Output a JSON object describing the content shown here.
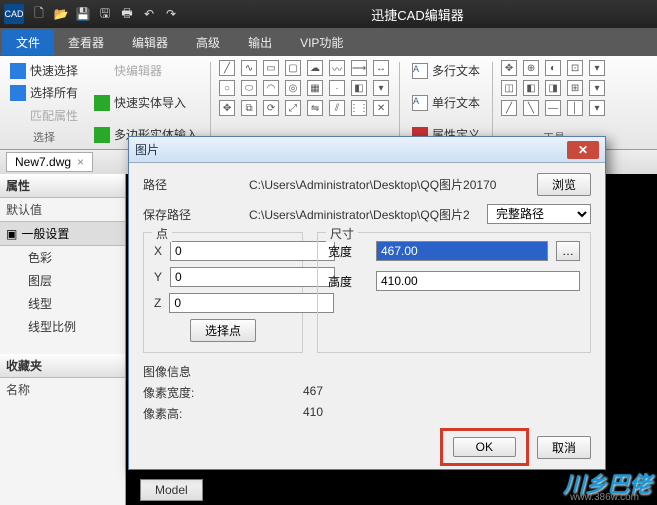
{
  "app": {
    "title": "迅捷CAD编辑器",
    "logo": "CAD"
  },
  "toolbar_icons": [
    "new",
    "open",
    "save",
    "saveall",
    "print",
    "undo",
    "redo"
  ],
  "menu": {
    "file": "文件",
    "view": "查看器",
    "editor": "编辑器",
    "advanced": "高级",
    "output": "输出",
    "vip": "VIP功能"
  },
  "ribbon": {
    "quick_select": "快速选择",
    "quick_editor": "快编辑器",
    "select_all": "选择所有",
    "quick_entity_import": "快速实体导入",
    "match_props": "匹配属性",
    "poly_entity_input": "多边形实体输入",
    "group_select": "选择",
    "mtext": "多行文本",
    "stext": "单行文本",
    "attdef": "属性定义",
    "group_tools": "工具"
  },
  "doc_tab": {
    "name": "New7.dwg"
  },
  "side": {
    "props": "属性",
    "default": "默认值",
    "section_general": "一般设置",
    "color": "色彩",
    "layer": "图层",
    "ltype": "线型",
    "lscale": "线型比例",
    "favorites": "收藏夹",
    "name": "名称"
  },
  "model_tab": "Model",
  "dialog": {
    "title": "图片",
    "path_label": "路径",
    "path_value": "C:\\Users\\Administrator\\Desktop\\QQ图片20170",
    "browse": "浏览",
    "save_path_label": "保存路径",
    "save_path_value": "C:\\Users\\Administrator\\Desktop\\QQ图片2",
    "full_path": "完整路径",
    "point_label": "点",
    "x": "X",
    "y": "Y",
    "z": "Z",
    "xv": "0",
    "yv": "0",
    "zv": "0",
    "pick_point": "选择点",
    "size_label": "尺寸",
    "width_label": "宽度",
    "height_label": "高度",
    "width_value": "467.00",
    "height_value": "410.00",
    "img_info": "图像信息",
    "px_width_label": "像素宽度:",
    "px_height_label": "像素高:",
    "px_width": "467",
    "px_height": "410",
    "ok": "OK",
    "cancel": "取消"
  },
  "watermark": {
    "main": "川乡巴佬",
    "sub": "www.386w.com"
  }
}
